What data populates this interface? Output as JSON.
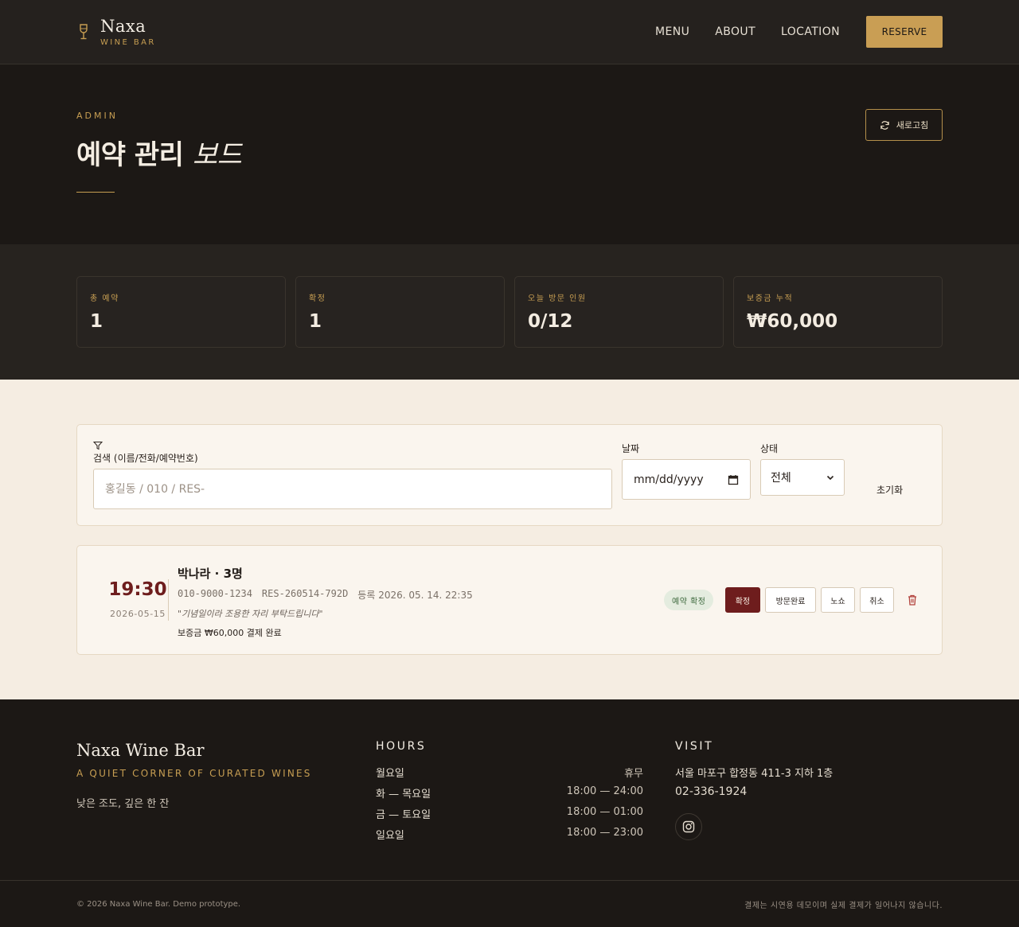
{
  "brand": {
    "name": "Naxa",
    "sub": "WINE BAR"
  },
  "nav": {
    "items": [
      "MENU",
      "ABOUT",
      "LOCATION"
    ],
    "reserve": "RESERVE"
  },
  "hero": {
    "eyebrow": "ADMIN",
    "title_main": "예약 관리",
    "title_em": "보드",
    "refresh": "새로고침"
  },
  "stats": [
    {
      "label": "총 예약",
      "value": "1"
    },
    {
      "label": "확정",
      "value": "1"
    },
    {
      "label": "오늘 방문 인원",
      "value": "0/12"
    },
    {
      "label": "보증금 누적",
      "value": "₩60,000"
    }
  ],
  "filter": {
    "search_label": "검색 (이름/전화/예약번호)",
    "search_placeholder": "홍길동 / 010 / RES-",
    "date_label": "날짜",
    "date_value": "mm/dd/yyyy",
    "status_label": "상태",
    "status_value": "전체",
    "reset": "초기화"
  },
  "reservation": {
    "time": "19:30",
    "date": "2026-05-15",
    "name": "박나라",
    "party": "3명",
    "phone": "010-9000-1234",
    "code": "RES-260514-792D",
    "registered": "등록 2026. 05. 14. 22:35",
    "note": "\"기념일이라 조용한 자리 부탁드립니다\"",
    "deposit": "보증금 ₩60,000 결제 완료",
    "badge": "예약 확정",
    "actions": [
      "확정",
      "방문완료",
      "노쇼",
      "취소"
    ]
  },
  "footer": {
    "brand": "Naxa Wine Bar",
    "tagline": "A QUIET CORNER OF CURATED WINES",
    "desc": "낮은 조도, 깊은 한 잔",
    "hours_title": "HOURS",
    "hours": [
      {
        "day": "월요일",
        "time": "휴무"
      },
      {
        "day": "화 — 목요일",
        "time": "18:00 — 24:00"
      },
      {
        "day": "금 — 토요일",
        "time": "18:00 — 01:00"
      },
      {
        "day": "일요일",
        "time": "18:00 — 23:00"
      }
    ],
    "visit_title": "VISIT",
    "address": "서울 마포구 합정동 411-3 지하 1층",
    "phone": "02-336-1924",
    "copyright": "© 2026 Naxa Wine Bar. Demo prototype.",
    "notice": "결제는 시연용 데모이며 실제 결제가 일어나지 않습니다."
  },
  "colors": {
    "accent": "#c99e54",
    "wine": "#6e1d1d",
    "dark": "#1c1815",
    "cream": "#f5ede2"
  }
}
